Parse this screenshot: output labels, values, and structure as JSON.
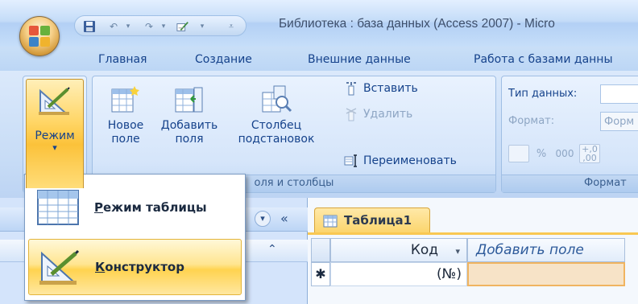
{
  "window": {
    "title": "Библиотека : база данных (Access 2007) - Micro"
  },
  "tabs": [
    "Главная",
    "Создание",
    "Внешние данные",
    "Работа с базами данны"
  ],
  "ribbon": {
    "views": {
      "mode_label": "Режим",
      "mode_arrow": "▾"
    },
    "fields_columns": {
      "new_field": [
        "Новое",
        "поле"
      ],
      "add_field": [
        "Добавить",
        "поля"
      ],
      "lookup_column": [
        "Столбец",
        "подстановок"
      ],
      "insert": "Вставить",
      "delete": "Удалить",
      "rename": "Переименовать",
      "group_label": "Поля и столбцы",
      "group_label_visible": "оля и столбцы"
    },
    "formatting": {
      "data_type_label": "Тип данных:",
      "format_label": "Формат:",
      "format_placeholder": "Форм",
      "percent": "%",
      "thousands": "000",
      "dec_inc": "+,0",
      "dec_dec": ",00",
      "group_label": "Формат"
    }
  },
  "mode_menu": {
    "items": [
      {
        "label": "Режим таблицы",
        "accel": "Р",
        "rest": "ежим таблицы"
      },
      {
        "label": "Конструктор",
        "accel": "К",
        "rest": "онструктор"
      }
    ]
  },
  "nav_pane": {
    "dropdown_icon": "▾",
    "collapse_icon": "«",
    "section_collapse_icon": "⌃"
  },
  "document": {
    "tab_label": "Таблица1",
    "columns": [
      "Код",
      "Добавить поле"
    ],
    "new_row_marker": "✱",
    "new_row_id": "(№)"
  },
  "colors": {
    "accent": "#ffd350",
    "ribbon": "#c7dcf6",
    "selected_tab": "#fbd46b"
  }
}
